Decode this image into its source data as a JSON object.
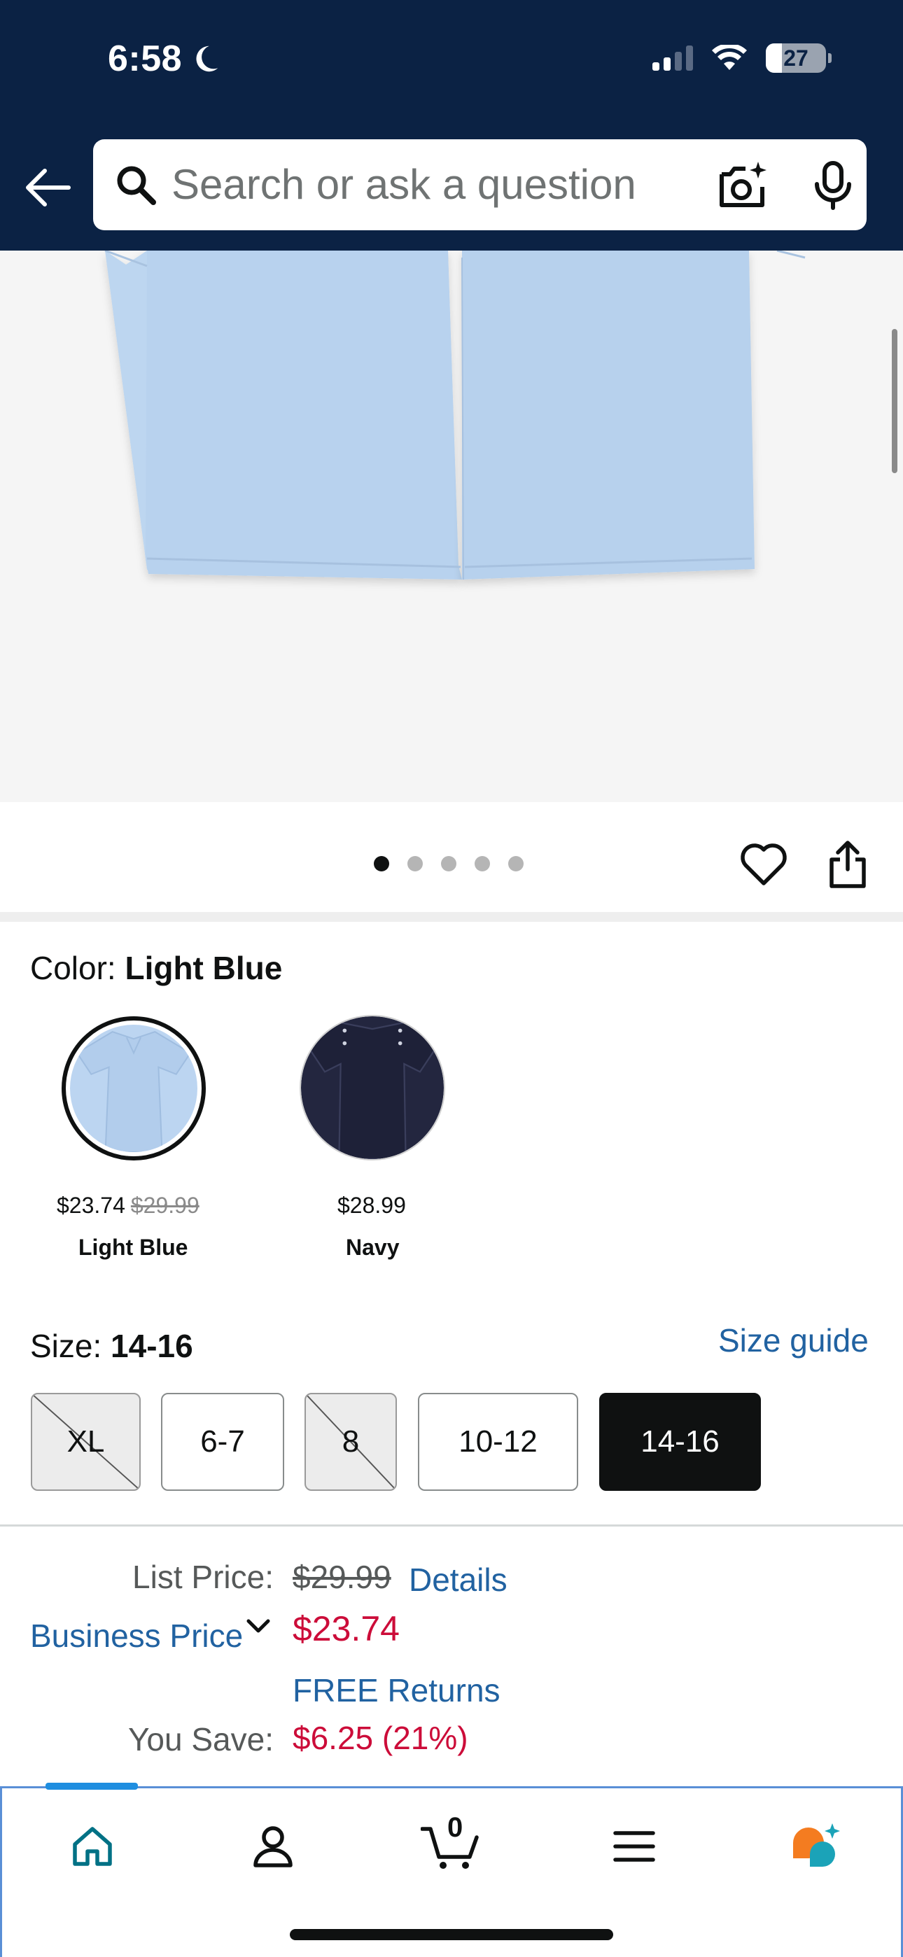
{
  "status_bar": {
    "time": "6:58",
    "battery": "27"
  },
  "header": {
    "search_placeholder": "Search or ask a question",
    "background": "#0B2244"
  },
  "gallery": {
    "image_count": 5,
    "active_index": 0
  },
  "color": {
    "label": "Color: ",
    "selected": "Light Blue",
    "options": [
      {
        "name": "Light Blue",
        "price": "$23.74",
        "list_price": "$29.99",
        "swatch": "#BBD4F0"
      },
      {
        "name": "Navy",
        "price": "$28.99",
        "list_price": "",
        "swatch": "#22253E"
      }
    ]
  },
  "size": {
    "label": "Size: ",
    "selected": "14-16",
    "guide_link": "Size guide",
    "options": [
      {
        "label": "XL",
        "available": false
      },
      {
        "label": "6-7",
        "available": true
      },
      {
        "label": "8",
        "available": false
      },
      {
        "label": "10-12",
        "available": true
      },
      {
        "label": "14-16",
        "available": true,
        "selected": true
      }
    ]
  },
  "pricing": {
    "list_price_label": "List Price:",
    "list_price": "$29.99",
    "details_link": "Details",
    "business_price_label": "Business Price",
    "business_price": "$23.74",
    "returns": "FREE Returns",
    "you_save_label": "You Save:",
    "you_save": "$6.25 (21%)"
  },
  "bottom_nav": {
    "cart_count": "0"
  },
  "colors": {
    "link": "#2162A1",
    "price_red": "#CC0C39",
    "text": "#0F1111"
  }
}
